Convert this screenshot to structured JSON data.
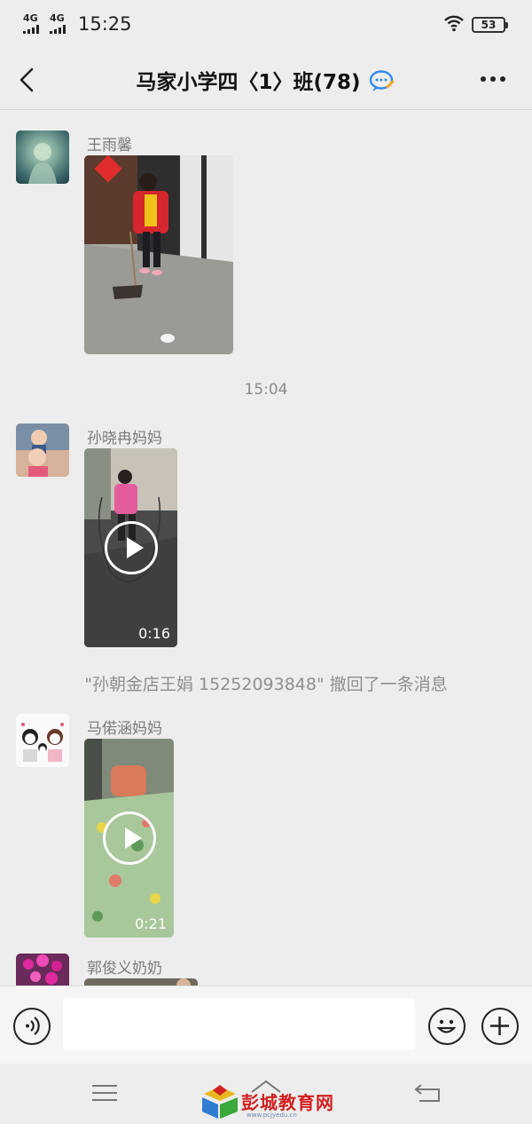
{
  "status_bar": {
    "signal_1": "4G",
    "signal_2": "4G",
    "time": "15:25",
    "battery": "53"
  },
  "header": {
    "title": "马家小学四〈1〉班(78)",
    "back_icon": "chevron-left-icon",
    "more_icon": "more-dots-icon"
  },
  "messages": [
    {
      "sender": "王雨馨",
      "type": "image"
    },
    {
      "sender": "孙晓冉妈妈",
      "type": "video",
      "duration": "0:16"
    },
    {
      "sender": "马偌涵妈妈",
      "type": "video",
      "duration": "0:21"
    },
    {
      "sender": "郭俊义奶奶",
      "type": "image"
    }
  ],
  "time_separator": "15:04",
  "system_message": "\"孙朝金店王娟 15252093848\" 撤回了一条消息",
  "input_bar": {
    "voice_icon": "voice-icon",
    "emoji_icon": "emoji-icon",
    "plus_icon": "plus-icon",
    "placeholder": ""
  },
  "nav_bar": {
    "menu_icon": "menu-icon",
    "home_icon": "home-icon",
    "back_icon": "back-arrow-icon"
  },
  "watermark": {
    "text": "彭城教育网",
    "url": "www.pcjyedu.cn"
  }
}
